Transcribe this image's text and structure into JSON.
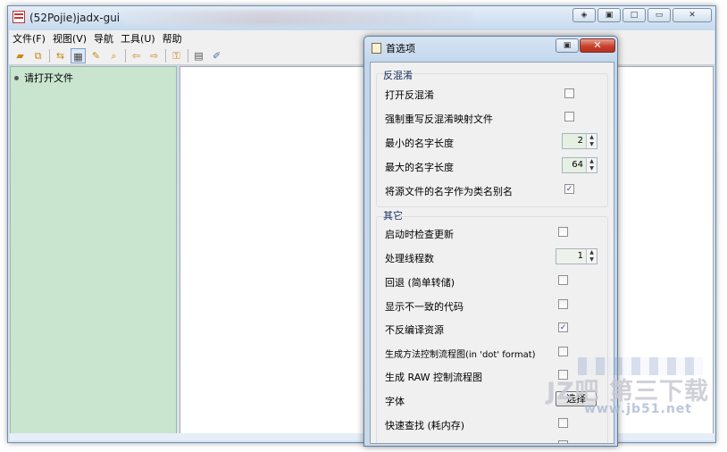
{
  "window": {
    "title": "(52Pojie)jadx-gui",
    "controls": [
      "◈",
      "▣",
      "□",
      "▭",
      "✕"
    ]
  },
  "menu": [
    "文件(F)",
    "视图(V)",
    "导航",
    "工具(U)",
    "帮助"
  ],
  "toolbar": {
    "icons": [
      "open-file-icon",
      "add-file-icon",
      "sync-icon",
      "flatten-icon",
      "search-text-icon",
      "search-class-icon",
      "back-icon",
      "forward-icon",
      "deobfuscation-icon",
      "log-icon",
      "preferences-icon"
    ]
  },
  "tree": {
    "placeholder": "请打开文件"
  },
  "dialog": {
    "title": "首选项",
    "min_glyph": "▣",
    "close_glyph": "✕",
    "deobf_group": "反混淆",
    "deobf": {
      "enable": {
        "label": "打开反混淆",
        "checked": false
      },
      "force": {
        "label": "强制重写反混淆映射文件",
        "checked": false
      },
      "min_len": {
        "label": "最小的名字长度",
        "value": "2"
      },
      "max_len": {
        "label": "最大的名字长度",
        "value": "64"
      },
      "use_source": {
        "label": "将源文件的名字作为类名别名",
        "checked": true
      }
    },
    "other_group": "其它",
    "other": {
      "check_update": {
        "label": "启动时检查更新",
        "checked": false
      },
      "threads": {
        "label": "处理线程数",
        "value": "1"
      },
      "fallback": {
        "label": "回退 (简单转储)",
        "checked": false
      },
      "inconsistent": {
        "label": "显示不一致的代码",
        "checked": false
      },
      "no_res": {
        "label": "不反编译资源",
        "checked": true
      },
      "cfg": {
        "label": "生成方法控制流程图(in 'dot' format)",
        "checked": false
      },
      "raw_cfg": {
        "label": "生成 RAW 控制流程图",
        "checked": false
      },
      "font": {
        "label": "字体",
        "button": "选择"
      },
      "fast_search": {
        "label": "快速查找 (耗内存)",
        "checked": false
      }
    }
  },
  "watermark": {
    "big": "JZ吧 第三下载",
    "url": "www.jb51.net"
  }
}
